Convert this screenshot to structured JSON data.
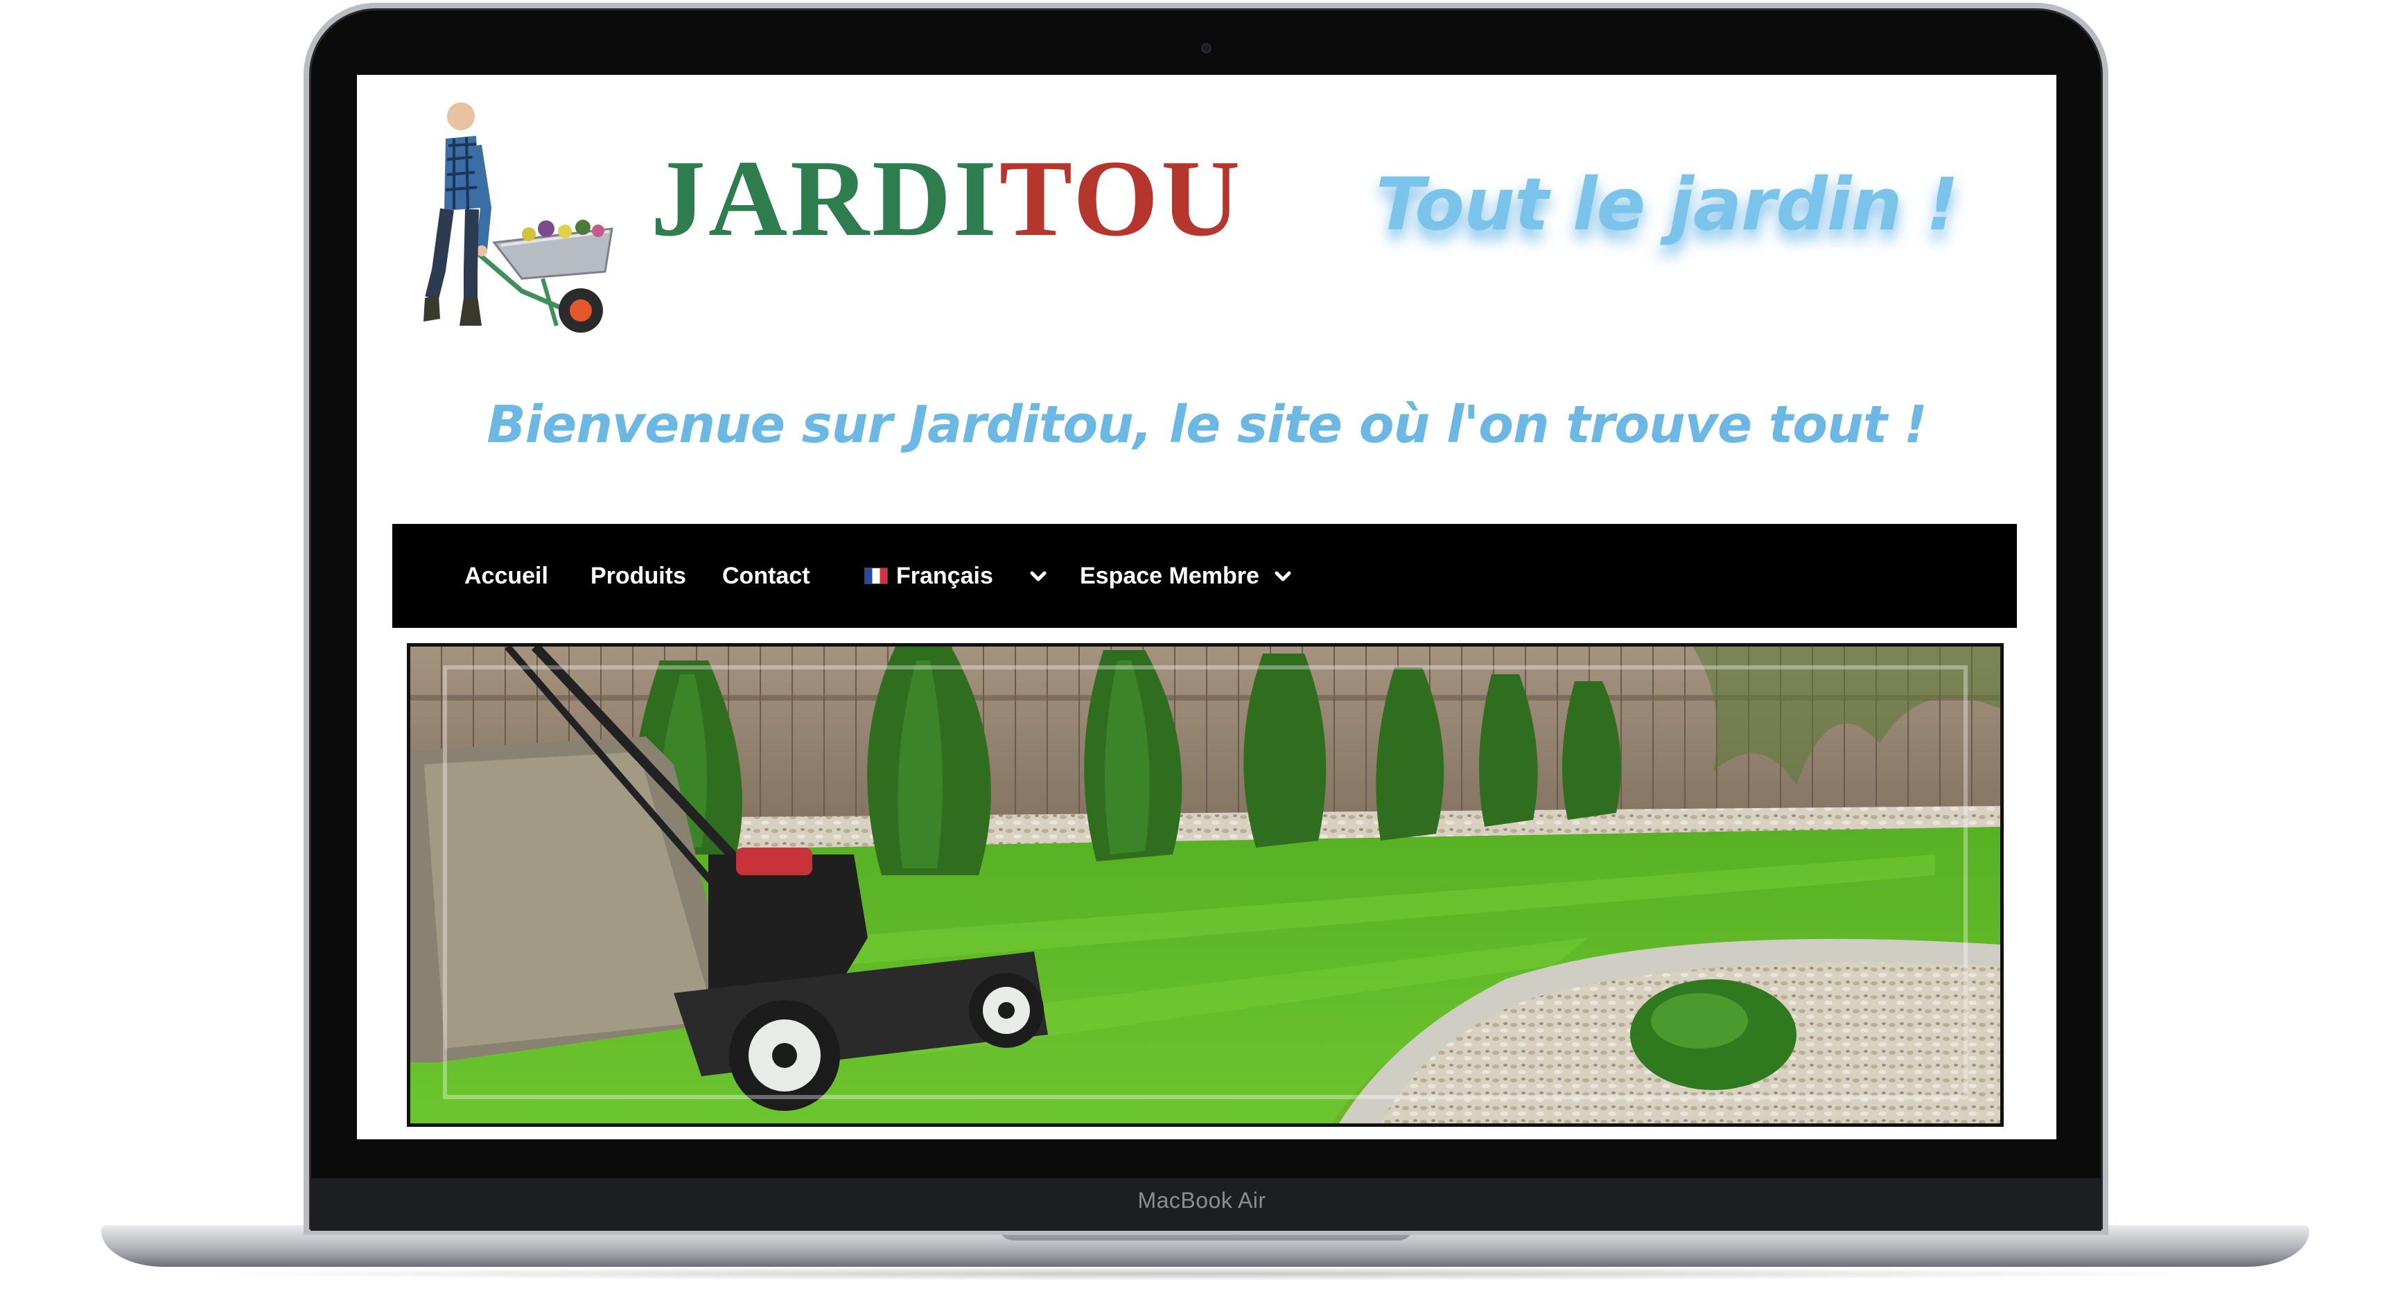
{
  "device": {
    "label": "MacBook Air"
  },
  "site": {
    "brand_part1": "JARDI",
    "brand_part2": "TOU",
    "tagline": "Tout le jardin !",
    "welcome": "Bienvenue sur Jarditou, le site où l'on trouve tout !",
    "colors": {
      "brand_green": "#2e7d4f",
      "brand_red": "#b4362c",
      "tagline_blue": "#7ac4ec",
      "nav_background": "#000000"
    }
  },
  "nav": {
    "items": [
      {
        "label": "Accueil"
      },
      {
        "label": "Produits"
      },
      {
        "label": "Contact"
      },
      {
        "label": "Français",
        "icon": "flag-fr-icon",
        "dropdown": true
      },
      {
        "label": "Espace Membre",
        "dropdown": true
      }
    ]
  },
  "hero": {
    "icon": "lawn-mower-garden-photo"
  }
}
